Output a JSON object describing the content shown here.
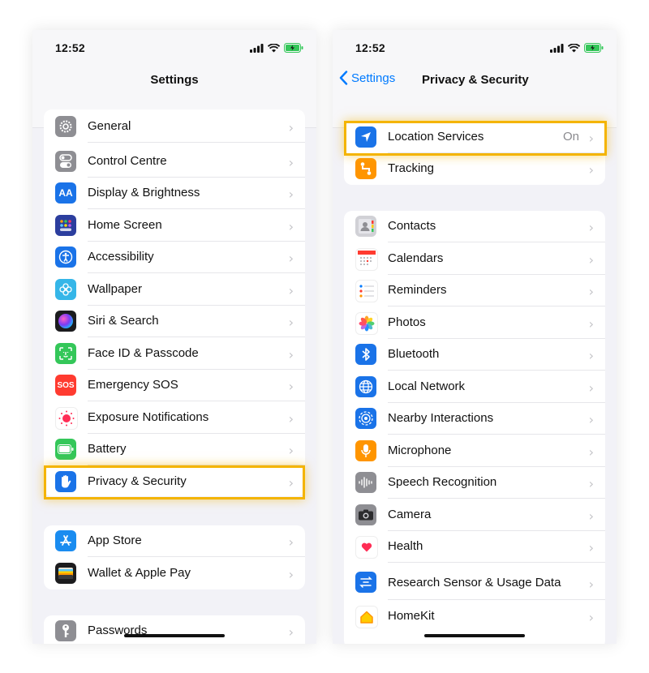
{
  "status_time": "12:52",
  "left": {
    "title": "Settings",
    "group1": [
      {
        "label": "General",
        "icon": "gear-icon",
        "color": "#8e8e93"
      },
      {
        "label": "Control Centre",
        "icon": "toggle-icon",
        "color": "#8e8e93"
      },
      {
        "label": "Display & Brightness",
        "icon": "text-size-icon",
        "color": "#1a73e8"
      },
      {
        "label": "Home Screen",
        "icon": "grid-icon",
        "color": "#2c3e9e"
      },
      {
        "label": "Accessibility",
        "icon": "accessibility-icon",
        "color": "#1a73e8"
      },
      {
        "label": "Wallpaper",
        "icon": "flower-icon",
        "color": "#35b6e8"
      },
      {
        "label": "Siri & Search",
        "icon": "siri-icon",
        "color": "#1c1c1e"
      },
      {
        "label": "Face ID & Passcode",
        "icon": "face-id-icon",
        "color": "#34c759"
      },
      {
        "label": "Emergency SOS",
        "icon": "sos-icon",
        "color": "#ff3b30",
        "text": "SOS"
      },
      {
        "label": "Exposure Notifications",
        "icon": "exposure-icon",
        "color": "#ffffff"
      },
      {
        "label": "Battery",
        "icon": "battery-icon",
        "color": "#34c759"
      },
      {
        "label": "Privacy & Security",
        "icon": "hand-icon",
        "color": "#1a73e8"
      }
    ],
    "group2": [
      {
        "label": "App Store",
        "icon": "app-store-icon",
        "color": "#1a8cf0"
      },
      {
        "label": "Wallet & Apple Pay",
        "icon": "wallet-icon",
        "color": "#1c1c1e"
      }
    ],
    "group3": [
      {
        "label": "Passwords",
        "icon": "key-icon",
        "color": "#8e8e93"
      }
    ]
  },
  "right": {
    "back_label": "Settings",
    "title": "Privacy & Security",
    "group1": [
      {
        "label": "Location Services",
        "icon": "location-arrow-icon",
        "color": "#1a73e8",
        "value": "On"
      },
      {
        "label": "Tracking",
        "icon": "tracking-icon",
        "color": "#ff9500"
      }
    ],
    "group2": [
      {
        "label": "Contacts",
        "icon": "contacts-icon",
        "color": "#d1d1d6"
      },
      {
        "label": "Calendars",
        "icon": "calendar-icon",
        "color": "#ffffff"
      },
      {
        "label": "Reminders",
        "icon": "reminders-icon",
        "color": "#ffffff"
      },
      {
        "label": "Photos",
        "icon": "photos-icon",
        "color": "#ffffff"
      },
      {
        "label": "Bluetooth",
        "icon": "bluetooth-icon",
        "color": "#1a73e8"
      },
      {
        "label": "Local Network",
        "icon": "globe-icon",
        "color": "#1a73e8"
      },
      {
        "label": "Nearby Interactions",
        "icon": "nearby-icon",
        "color": "#1a73e8"
      },
      {
        "label": "Microphone",
        "icon": "microphone-icon",
        "color": "#ff9500"
      },
      {
        "label": "Speech Recognition",
        "icon": "waveform-icon",
        "color": "#8e8e93"
      },
      {
        "label": "Camera",
        "icon": "camera-icon",
        "color": "#8e8e93"
      },
      {
        "label": "Health",
        "icon": "heart-icon",
        "color": "#ffffff"
      },
      {
        "label": "Research Sensor & Usage Data",
        "icon": "research-icon",
        "color": "#1a73e8"
      },
      {
        "label": "HomeKit",
        "icon": "home-icon",
        "color": "#ffffff"
      }
    ]
  },
  "highlight_color": "#f4b400",
  "chevron": "›"
}
